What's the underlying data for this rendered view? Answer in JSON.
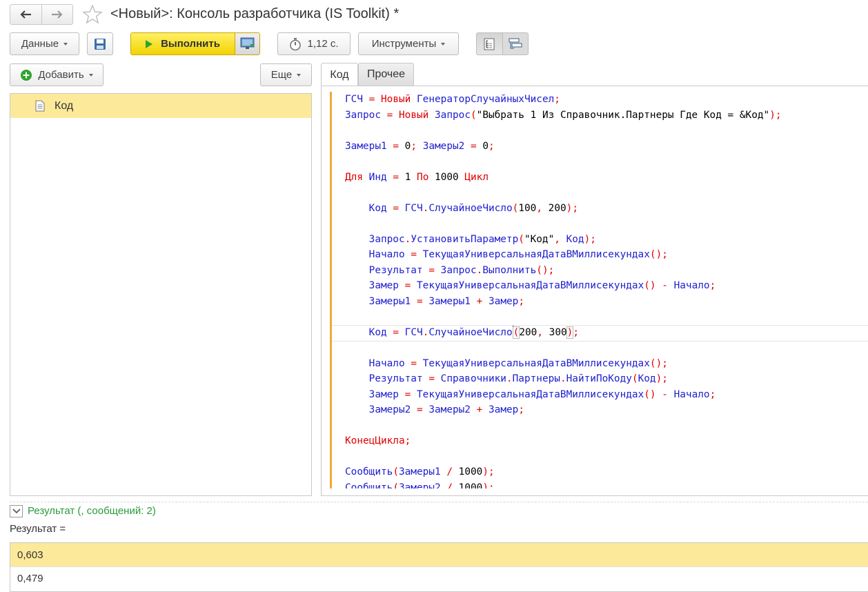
{
  "window": {
    "title": "<Новый>: Консоль разработчика (IS Toolkit) *",
    "nav": {
      "back_icon": "arrow-left-icon",
      "forward_icon": "arrow-right-icon",
      "favorite_icon": "star-icon"
    }
  },
  "toolbar": {
    "data_label": "Данные",
    "save_icon": "floppy-disk-icon",
    "run_label": "Выполнить",
    "timer_value": "1,12 с.",
    "tools_label": "Инструменты",
    "run_color": "#f5d800"
  },
  "left_panel": {
    "add_label": "Добавить",
    "more_label": "Еще",
    "items": [
      {
        "label": "Код",
        "selected": true
      }
    ]
  },
  "tabs": [
    {
      "label": "Код",
      "active": true
    },
    {
      "label": "Прочее",
      "active": false
    }
  ],
  "code_lines": [
    "ГСЧ = Новый ГенераторСлучайныхЧисел;",
    "Запрос = Новый Запрос(\"Выбрать 1 Из Справочник.Партнеры Где Код = &Код\");",
    "",
    "Замеры1 = 0; Замеры2 = 0;",
    "",
    "Для Инд = 1 По 1000 Цикл",
    "",
    "    Код = ГСЧ.СлучайноеЧисло(100, 200);",
    "",
    "    Запрос.УстановитьПараметр(\"Код\", Код);",
    "    Начало = ТекущаяУниверсальнаяДатаВМиллисекундах();",
    "    Результат = Запрос.Выполнить();",
    "    Замер = ТекущаяУниверсальнаяДатаВМиллисекундах() - Начало;",
    "    Замеры1 = Замеры1 + Замер;",
    "",
    "    Код = ГСЧ.СлучайноеЧисло(200, 300);",
    "",
    "    Начало = ТекущаяУниверсальнаяДатаВМиллисекундах();",
    "    Результат = Справочники.Партнеры.НайтиПоКоду(Код);",
    "    Замер = ТекущаяУниверсальнаяДатаВМиллисекундах() - Начало;",
    "    Замеры2 = Замеры2 + Замер;",
    "",
    "КонецЦикла;",
    "",
    "Сообщить(Замеры1 / 1000);",
    "Сообщить(Замеры2 / 1000);"
  ],
  "results": {
    "header": "Результат (, сообщений: 2)",
    "label": "Результат =",
    "values": [
      "0,603",
      "0,479"
    ]
  }
}
